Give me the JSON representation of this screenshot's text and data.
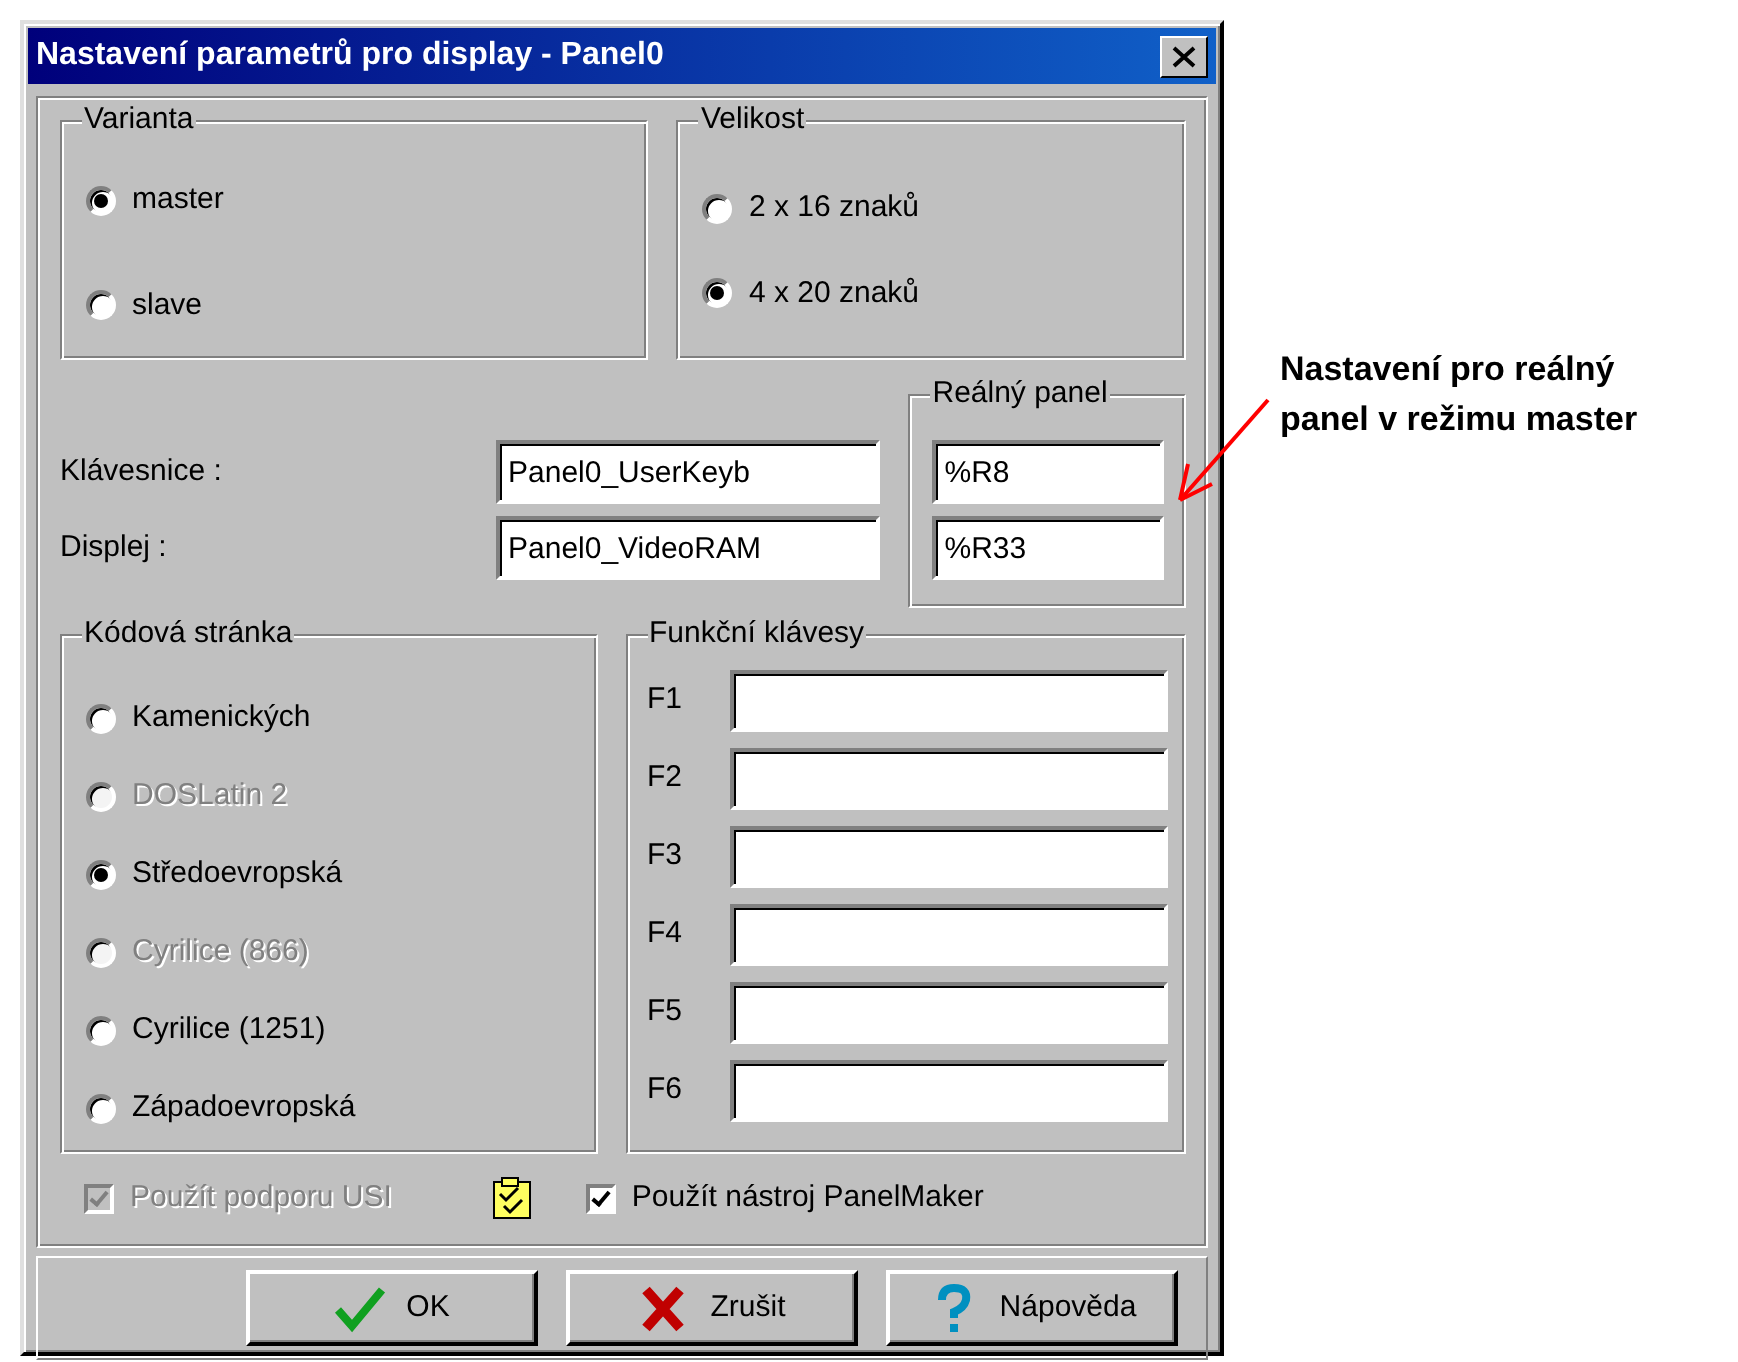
{
  "window": {
    "title": "Nastavení parametrů pro display - Panel0"
  },
  "variant": {
    "title": "Varianta",
    "options": [
      {
        "label": "master",
        "selected": true
      },
      {
        "label": "slave",
        "selected": false
      }
    ]
  },
  "size": {
    "title": "Velikost",
    "options": [
      {
        "label": "2 x 16 znaků",
        "selected": false
      },
      {
        "label": "4 x 20 znaků",
        "selected": true
      }
    ]
  },
  "fields": [
    {
      "label": "Klávesnice :",
      "value": "Panel0_UserKeyb"
    },
    {
      "label": "Displej :",
      "value": "Panel0_VideoRAM"
    }
  ],
  "real_panel": {
    "title": "Reálný panel",
    "fields": [
      {
        "value": "%R8"
      },
      {
        "value": "%R33"
      }
    ]
  },
  "code_page": {
    "title": "Kódová stránka",
    "options": [
      {
        "label": "Kamenických",
        "selected": false,
        "disabled": false
      },
      {
        "label": "DOSLatin 2",
        "selected": false,
        "disabled": true
      },
      {
        "label": "Středoevropská",
        "selected": true,
        "disabled": false
      },
      {
        "label": "Cyrilice (866)",
        "selected": false,
        "disabled": true
      },
      {
        "label": "Cyrilice (1251)",
        "selected": false,
        "disabled": false
      },
      {
        "label": "Západoevropská",
        "selected": false,
        "disabled": false
      }
    ]
  },
  "function_keys": {
    "title": "Funkční klávesy",
    "keys": [
      {
        "label": "F1"
      },
      {
        "label": "F2"
      },
      {
        "label": "F3"
      },
      {
        "label": "F4"
      },
      {
        "label": "F5"
      },
      {
        "label": "F6"
      }
    ]
  },
  "checkboxes": [
    {
      "label": "Použít podporu USI",
      "checked": true,
      "disabled": true
    },
    {
      "label": "Použít nástroj PanelMaker",
      "checked": true,
      "disabled": false
    }
  ],
  "buttons": [
    {
      "label": "OK",
      "kind": "ok"
    },
    {
      "label": "Zrušit",
      "kind": "cancel"
    },
    {
      "label": "Nápověda",
      "kind": "help"
    }
  ],
  "annotation": {
    "lines": [
      "Nastavení pro reálný",
      "panel v režimu master"
    ]
  }
}
